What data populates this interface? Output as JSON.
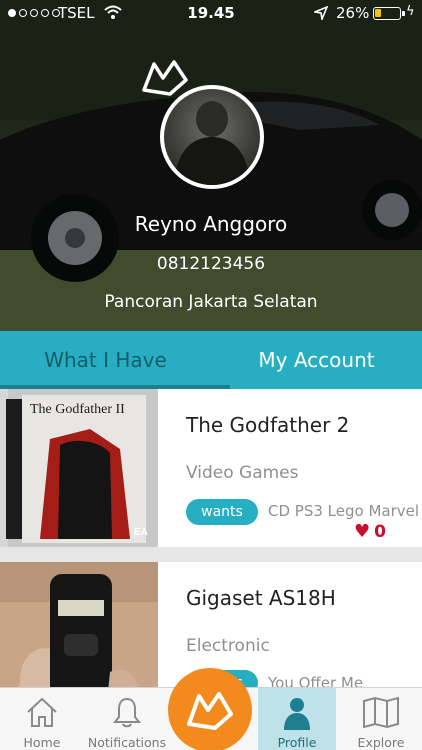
{
  "status_bar": {
    "carrier": "TSEL",
    "time": "19.45",
    "battery": "26%",
    "battery_level": 0.26,
    "signal_bars_filled": 1,
    "signal_bars_total": 5
  },
  "profile": {
    "name": "Reyno Anggoro",
    "phone": "0812123456",
    "address": "Pancoran Jakarta Selatan"
  },
  "tabs": [
    {
      "label": "What I Have",
      "active": true
    },
    {
      "label": "My Account",
      "active": false
    }
  ],
  "items": [
    {
      "title": "The Godfather 2",
      "category": "Video Games",
      "tag": "wants",
      "wants_text": "CD PS3 Lego Marvel",
      "likes": "0",
      "thumb_text": "The Godfather II"
    },
    {
      "title": "Gigaset AS18H",
      "category": "Electronic",
      "tag": "wants",
      "wants_text": "You Offer Me"
    }
  ],
  "tabbar": {
    "home": "Home",
    "notifications": "Notifications",
    "profile": "Profile",
    "explore": "Explore"
  },
  "colors": {
    "accent": "#27aec2",
    "center_button": "#f38a1d",
    "like": "#c8102e"
  }
}
